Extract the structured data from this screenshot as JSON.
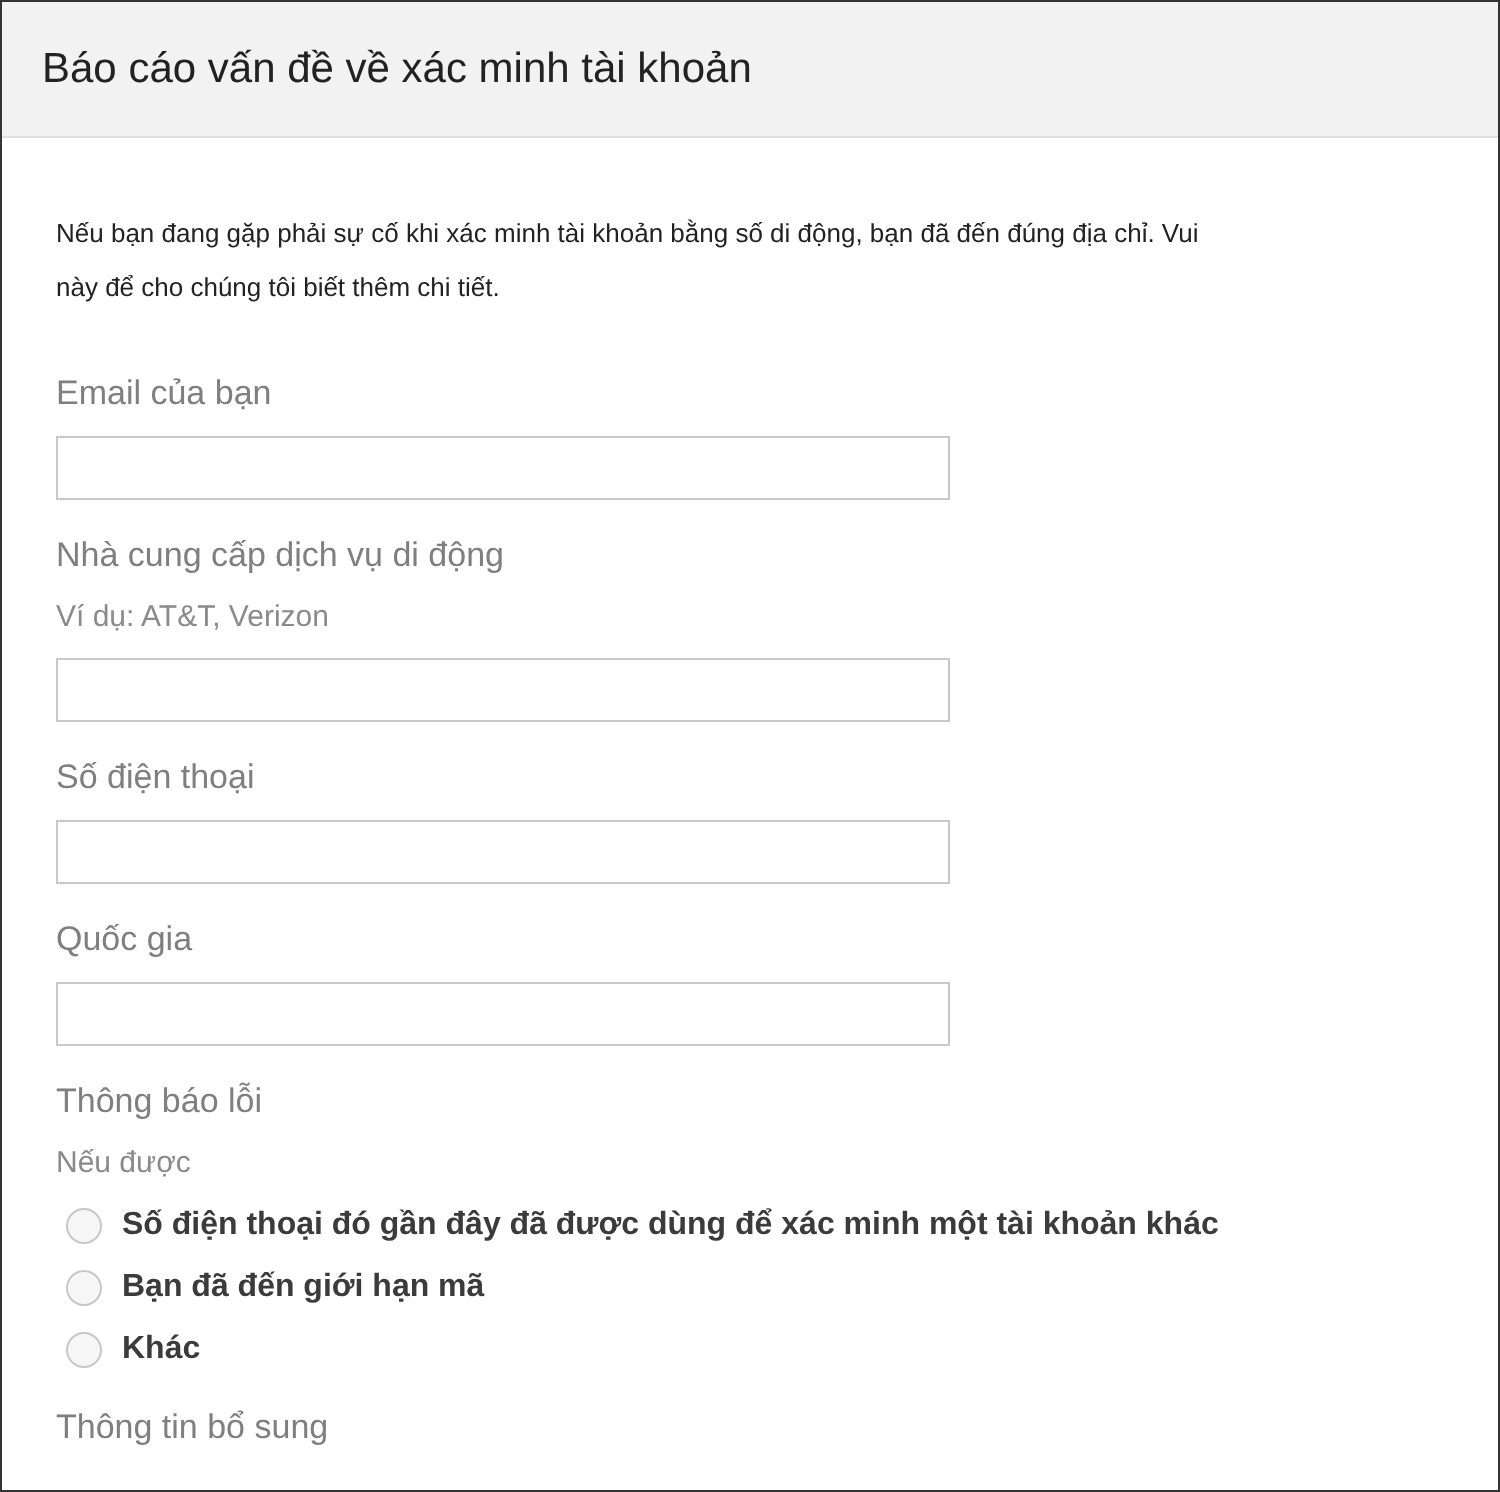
{
  "header": {
    "title": "Báo cáo vấn đề về xác minh tài khoản"
  },
  "intro_lines": [
    "Nếu bạn đang gặp phải sự cố khi xác minh tài khoản bằng số di động, bạn đã đến đúng địa chỉ. Vui",
    "này để cho chúng tôi biết thêm chi tiết."
  ],
  "fields": [
    {
      "kind": "input",
      "label": "Email của bạn"
    },
    {
      "kind": "input",
      "label": "Nhà cung cấp dịch vụ di động",
      "hint": "Ví dụ: AT&T, Verizon"
    },
    {
      "kind": "input",
      "label": "Số điện thoại"
    },
    {
      "kind": "input",
      "label": "Quốc gia"
    },
    {
      "kind": "radio",
      "label": "Thông báo lỗi",
      "hint": "Nếu được",
      "options": [
        {
          "label": "Số điện thoại đó gần đây đã được dùng để xác minh một tài khoản khác",
          "selected": false
        },
        {
          "label": "Bạn đã đến giới hạn mã",
          "selected": false
        },
        {
          "label": "Khác",
          "selected": false
        }
      ]
    },
    {
      "kind": "label",
      "label": "Thông tin bổ sung"
    }
  ]
}
